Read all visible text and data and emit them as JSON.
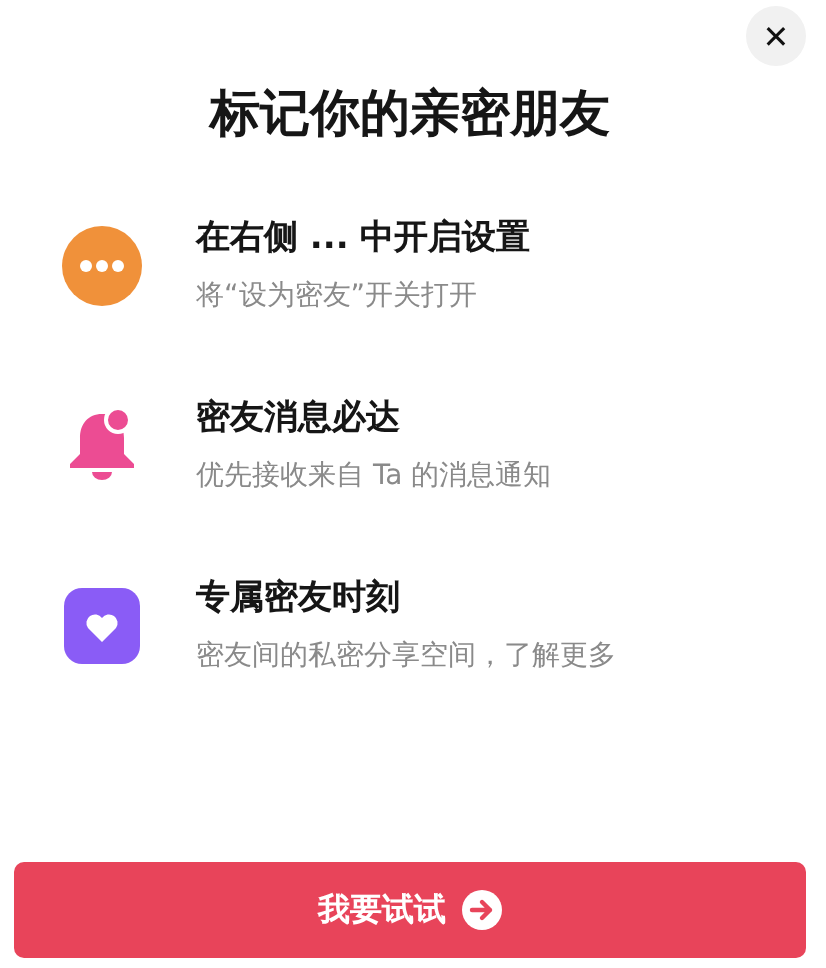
{
  "close_button": {
    "label": "✕"
  },
  "title": "标记你的亲密朋友",
  "features": [
    {
      "kind": "dots",
      "title": "在右侧 ... 中开启设置",
      "subtitle": "将“设为密友”开关打开"
    },
    {
      "kind": "bell",
      "title": "密友消息必达",
      "subtitle": "优先接收来自 Ta 的消息通知"
    },
    {
      "kind": "heart",
      "title": "专属密友时刻",
      "subtitle": "密友间的私密分享空间，了解更多"
    }
  ],
  "primary_button": {
    "label": "我要试试"
  }
}
